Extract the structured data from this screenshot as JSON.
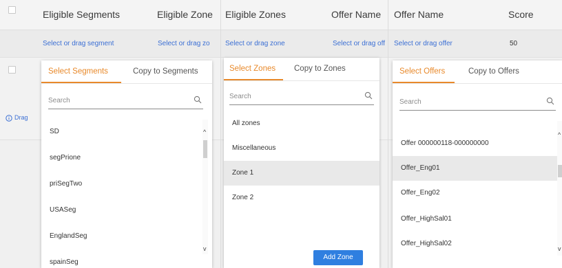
{
  "table": {
    "headers": {
      "segments": "Eligible Segments",
      "zones_cut": "Eligible Zone",
      "zones": "Eligible Zones",
      "offer_cut": "Offer Name",
      "offer": "Offer Name",
      "score": "Score"
    },
    "row1": {
      "segment_link": "Select or drag segment",
      "zone_link_cut": "Select or drag zo",
      "zone_link": "Select or drag zone",
      "offer_link_cut": "Select or drag off",
      "offer_link": "Select or drag offer",
      "score": "50"
    },
    "drag_hint": "Drag"
  },
  "segments_popup": {
    "tab_select": "Select Segments",
    "tab_copy": "Copy to Segments",
    "search_placeholder": "Search",
    "items": [
      "SD",
      "segPrione",
      "priSegTwo",
      "USASeg",
      "EnglandSeg",
      "spainSeg"
    ]
  },
  "zones_popup": {
    "tab_select": "Select Zones",
    "tab_copy": "Copy to Zones",
    "search_placeholder": "Search",
    "items": [
      "All zones",
      "Miscellaneous",
      "Zone 1",
      "Zone 2"
    ],
    "highlighted_index": 2,
    "add_button": "Add Zone"
  },
  "offers_popup": {
    "tab_select": "Select Offers",
    "tab_copy": "Copy to Offers",
    "search_placeholder": "Search",
    "items": [
      "Offer 000000118-000000000",
      "Offer_Eng01",
      "Offer_Eng02",
      "Offer_HighSal01",
      "Offer_HighSal02"
    ],
    "highlighted_index": 1
  },
  "icons": {
    "search": "search-icon",
    "info": "info-circle-icon",
    "scroll_up": "chevron-up-icon",
    "scroll_down": "chevron-down-icon"
  },
  "colors": {
    "accent": "#e8892a",
    "link": "#3b6fd4",
    "button": "#2f7fe0"
  }
}
